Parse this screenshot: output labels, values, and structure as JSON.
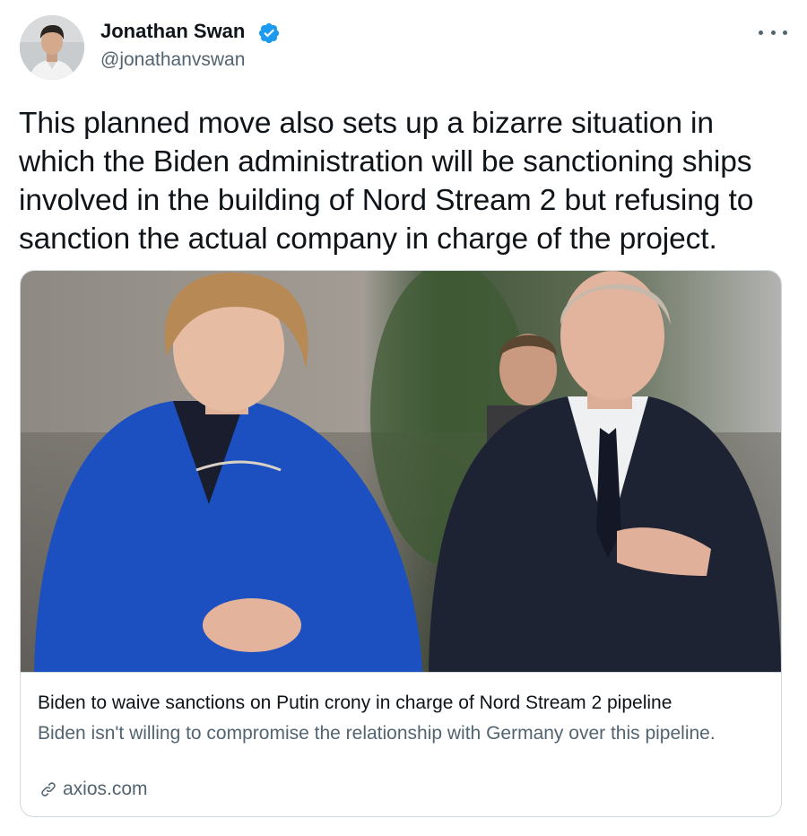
{
  "author": {
    "name": "Jonathan Swan",
    "handle": "@jonathanvswan",
    "verified": true,
    "avatar_icon": "avatar-photo"
  },
  "more_icon": "more-horizontal-icon",
  "tweet": {
    "text": "This planned move also sets up a bizarre situation in which the Biden administration will be sanctioning ships involved in the building of Nord Stream 2 but refusing to sanction the actual company in charge of the project."
  },
  "card": {
    "image_icon": "article-photo",
    "title": "Biden to waive sanctions on Putin crony in charge of Nord Stream 2 pipeline",
    "description": "Biden isn't willing to compromise the relationship with Germany over this pipeline.",
    "domain": "axios.com",
    "domain_icon": "link-icon"
  },
  "colors": {
    "text_primary": "#0f1419",
    "text_secondary": "#536471",
    "verified_blue": "#1d9bf0",
    "border": "#cfd9de"
  }
}
